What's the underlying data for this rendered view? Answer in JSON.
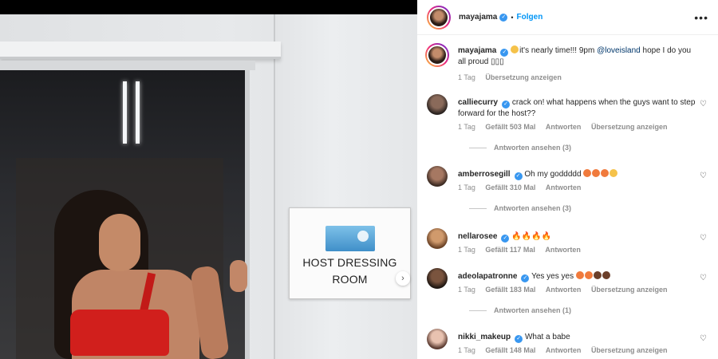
{
  "header": {
    "username": "mayajama",
    "follow_label": "Folgen",
    "more_icon": "more-dots-icon"
  },
  "media": {
    "sign_text_line1": "HOST DRESSING",
    "sign_text_line2": "ROOM"
  },
  "caption": {
    "username": "mayajama",
    "text_before": "it's nearly time!!! 9pm",
    "mention": "@loveisland",
    "text_after": "hope I do you all proud",
    "time": "1 Tag",
    "translate": "Übersetzung anzeigen"
  },
  "comments": [
    {
      "username": "calliecurry",
      "text": "crack on! what happens when the guys want to step forward for the host??",
      "time": "1 Tag",
      "likes": "Gefällt 503 Mal",
      "reply": "Antworten",
      "translate": "Übersetzung anzeigen",
      "view_replies": "Antworten ansehen (3)"
    },
    {
      "username": "amberrosegill",
      "text": "Oh my goddddd",
      "time": "1 Tag",
      "likes": "Gefällt 310 Mal",
      "reply": "Antworten",
      "view_replies": "Antworten ansehen (3)"
    },
    {
      "username": "nellarosee",
      "text": "",
      "time": "1 Tag",
      "likes": "Gefällt 117 Mal",
      "reply": "Antworten"
    },
    {
      "username": "adeolapatronne",
      "text": "Yes yes yes",
      "time": "1 Tag",
      "likes": "Gefällt 183 Mal",
      "reply": "Antworten",
      "translate": "Übersetzung anzeigen",
      "view_replies": "Antworten ansehen (1)"
    },
    {
      "username": "nikki_makeup",
      "text": "What a babe",
      "time": "1 Tag",
      "likes": "Gefällt 148 Mal",
      "reply": "Antworten",
      "translate": "Übersetzung anzeigen"
    }
  ],
  "colors": {
    "link": "#0095f6",
    "verified": "#3897f0",
    "muted": "#8e8e8e"
  }
}
